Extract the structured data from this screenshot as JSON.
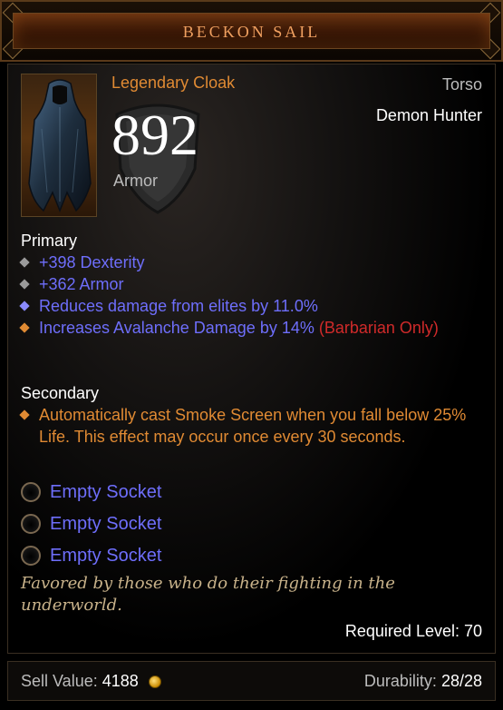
{
  "item": {
    "name": "BECKON SAIL",
    "rarity_type": "Legendary Cloak",
    "slot": "Torso",
    "class": "Demon Hunter",
    "armor_value": "892",
    "armor_label": "Armor"
  },
  "primary": {
    "title": "Primary",
    "affixes": [
      {
        "text": "+398 Dexterity"
      },
      {
        "text": "+362 Armor"
      },
      {
        "text": "Reduces damage from elites by 11.0%"
      },
      {
        "text": "Increases Avalanche Damage by 14%",
        "suffix": "(Barbarian Only)"
      }
    ]
  },
  "secondary": {
    "title": "Secondary",
    "affixes": [
      {
        "text": "Automatically cast Smoke Screen when you fall below 25% Life. This effect may occur once every 30 seconds."
      }
    ]
  },
  "sockets": [
    {
      "label": "Empty Socket"
    },
    {
      "label": "Empty Socket"
    },
    {
      "label": "Empty Socket"
    }
  ],
  "flavor": "Favored by those who do their fighting in the underworld.",
  "required_level": "Required Level: 70",
  "footer": {
    "sell_label": "Sell Value:",
    "sell_value": "4188",
    "durability_label": "Durability:",
    "durability_value": "28/28"
  },
  "colors": {
    "legendary_orange": "#e08a33",
    "magic_blue": "#6e6efb",
    "class_restricted_red": "#d02a2a",
    "flavor_tan": "#c8b28a"
  },
  "icons": {
    "item": "cloak-icon",
    "currency": "gold-coin-icon",
    "socket": "socket-ring-icon"
  }
}
